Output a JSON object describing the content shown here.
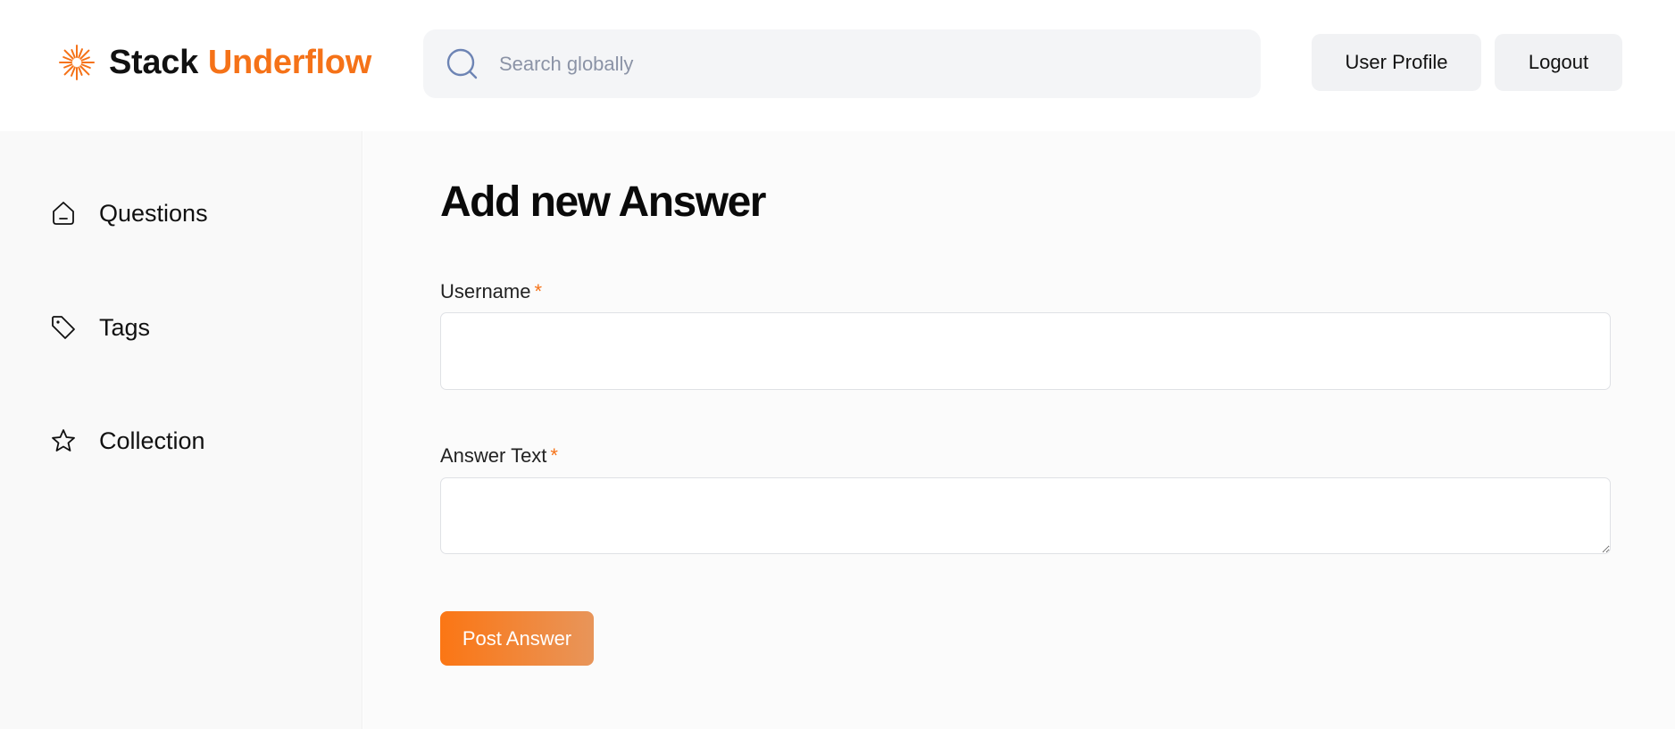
{
  "brand": {
    "name_part1": "Stack",
    "name_part2": "Underflow",
    "accent_color": "#f57218"
  },
  "search": {
    "placeholder": "Search globally",
    "value": "",
    "icon": "search-icon"
  },
  "header": {
    "profile_label": "User Profile",
    "logout_label": "Logout"
  },
  "sidebar": {
    "items": [
      {
        "label": "Questions",
        "icon": "home-icon"
      },
      {
        "label": "Tags",
        "icon": "tag-icon"
      },
      {
        "label": "Collection",
        "icon": "star-icon"
      }
    ]
  },
  "form": {
    "title": "Add new Answer",
    "username_label": "Username",
    "answer_label": "Answer Text",
    "required_marker": "*",
    "username_value": "",
    "answer_value": "",
    "submit_label": "Post Answer"
  }
}
